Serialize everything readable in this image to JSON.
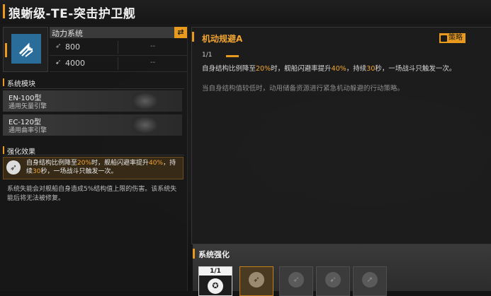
{
  "title": "狼蜥级-TE-突击护卫舰",
  "module": {
    "name": "动力系统",
    "swap_icon": "⇄",
    "stats": [
      {
        "icon": "engine-power-icon",
        "value": "800",
        "extra": "--"
      },
      {
        "icon": "thrust-icon",
        "value": "4000",
        "extra": "--"
      }
    ]
  },
  "system_modules": {
    "label": "系统模块",
    "items": [
      {
        "name": "EN-100型",
        "desc": "通用矢量引擎"
      },
      {
        "name": "EC-120型",
        "desc": "通用曲率引擎"
      }
    ]
  },
  "enhancement": {
    "label": "强化效果",
    "parts": [
      "自身结构比例降至",
      "20%",
      "时，舰船闪避率提升",
      "40%",
      "，持续",
      "30",
      "秒，一场战斗只触发一次。"
    ],
    "note": "系统失能会对舰船自身造成5%结构值上限的伤害。该系统失能后将无法被修复。"
  },
  "skill": {
    "name": "机动规避A",
    "tag": "策略",
    "level": "1/1",
    "desc_parts": [
      "自身结构比例降至",
      "20%",
      "时，舰船闪避率提升",
      "40%",
      "，持续",
      "30",
      "秒，一场战斗只触发一次。"
    ],
    "desc2": "当自身结构值较低时，动用储备资源进行紧急机动躲避的行动策略。"
  },
  "system_enhance": {
    "label": "系统强化",
    "active_level": "1/1",
    "slots": [
      "active",
      "selected",
      "locked",
      "locked",
      "locked"
    ]
  },
  "colors": {
    "accent": "#e79a1d",
    "highlight": "#f2a531",
    "module_blue": "#2a6c9a"
  }
}
